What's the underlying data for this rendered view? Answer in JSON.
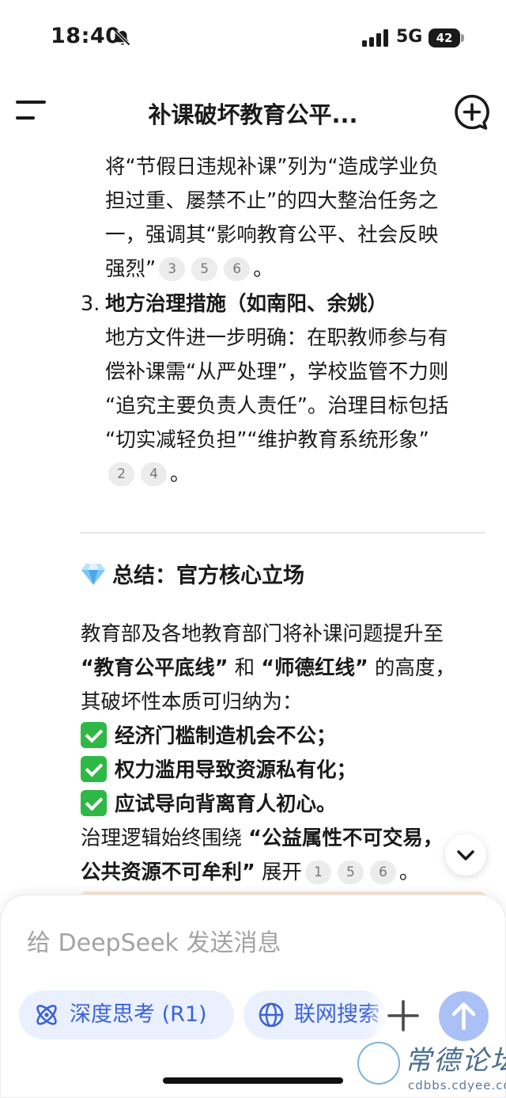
{
  "status_bar": {
    "time": "18:40",
    "network": "5G",
    "battery": "42"
  },
  "header": {
    "title": "补课破坏教育公平..."
  },
  "content": {
    "item2_tail": {
      "lines": [
        "将“节假日违规补课”列为“造成学业负",
        "担过重、屡禁不止”的四大整治任务之",
        "一，强调其“影响教育公平、社会反映"
      ],
      "last_text": "强烈”",
      "refs": [
        "3",
        "5",
        "6"
      ],
      "end": "。"
    },
    "item3": {
      "number": "3.",
      "heading": "地方治理措施（如南阳、余姚）",
      "lines": [
        "地方文件进一步明确：在职教师参与有",
        "偿补课需“从严处理”，学校监管不力则",
        "“追究主要负责人责任”。治理目标包括",
        "“切实减轻负担”“维护教育系统形象”"
      ],
      "refs": [
        "2",
        "4"
      ],
      "end": "。"
    },
    "summary": {
      "icon": "gem-icon",
      "title": "总结：官方核心立场",
      "intro_line1": "教育部及各地教育部门将补课问题提升至",
      "bold1": "“教育公平底线”",
      "mid": " 和 ",
      "bold2": "“师德红线”",
      "tail2": " 的高度，",
      "intro_line3": "其破坏性本质可归纳为：",
      "points": [
        "经济门槛制造机会不公；",
        "权力滥用导致资源私有化；",
        "应试导向背离育人初心。"
      ],
      "closing_prefix": "治理逻辑始终围绕 ",
      "closing_bold1": "“公益属性不可交易，",
      "closing_bold2": "公共资源不可牟利”",
      "closing_suffix": " 展开",
      "refs": [
        "1",
        "5",
        "6"
      ],
      "end": "。"
    }
  },
  "composer": {
    "placeholder": "给 DeepSeek 发送消息",
    "deep_think_label": "深度思考 (R1)",
    "web_search_label": "联网搜索"
  },
  "watermark": {
    "name": "常德论坛",
    "url": "cdbbs.cdyee.com"
  },
  "colors": {
    "accent": "#3b63d8",
    "chip_bg": "#eaf0fe",
    "send_disabled": "#aac0f7",
    "check": "#2fb845"
  }
}
